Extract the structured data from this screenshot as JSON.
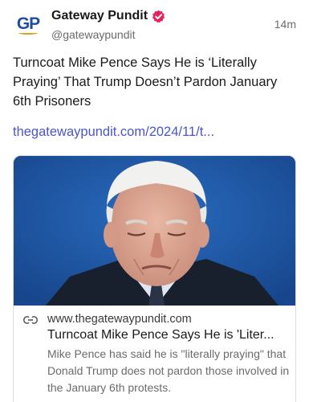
{
  "post": {
    "author_name": "Gateway Pundit",
    "handle": "@gatewaypundit",
    "timestamp": "14m",
    "avatar_text": "GP",
    "text": "Turncoat Mike Pence Says He is ‘Literally Praying’ That Trump Doesn’t Pardon January 6th Prisoners",
    "link": "thegatewaypundit.com/2024/11/t..."
  },
  "card": {
    "domain": "www.thegatewaypundit.com",
    "title": "Turncoat Mike Pence Says He is 'Liter...",
    "description": "Mike Pence has said he is \"literally praying\" that Donald Trump does not pardon those involved in the January 6th protests."
  },
  "icons": {
    "verified": "verified-badge-icon",
    "link": "link-icon"
  },
  "colors": {
    "verified": "#e0245e",
    "link": "#4a55c8",
    "avatar_text": "#1f4ea1",
    "image_background": "#1f57a6"
  }
}
